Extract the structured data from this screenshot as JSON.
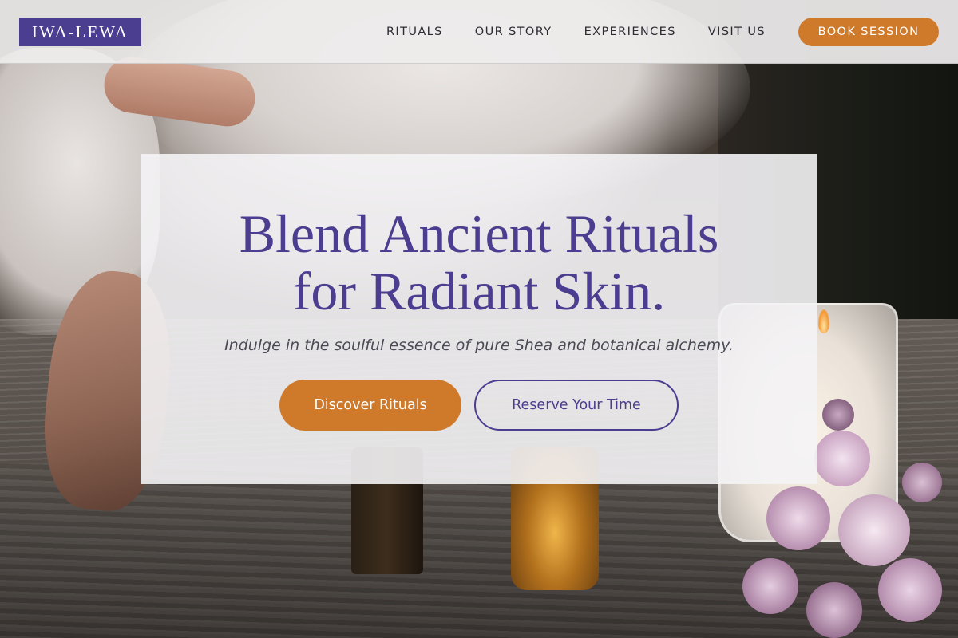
{
  "brand": {
    "logo_text": "IWA-LEWA"
  },
  "nav": {
    "links": [
      "RITUALS",
      "OUR STORY",
      "EXPERIENCES",
      "VISIT US"
    ],
    "cta_label": "BOOK SESSION"
  },
  "hero": {
    "title_line1": "Blend Ancient Rituals",
    "title_line2": "for Radiant Skin.",
    "subtitle": "Indulge in the soulful essence of pure Shea and botanical alchemy.",
    "primary_cta": "Discover Rituals",
    "secondary_cta": "Reserve Your Time"
  },
  "colors": {
    "brand_purple": "#4b3d8f",
    "accent_orange": "#cf7a2b"
  }
}
